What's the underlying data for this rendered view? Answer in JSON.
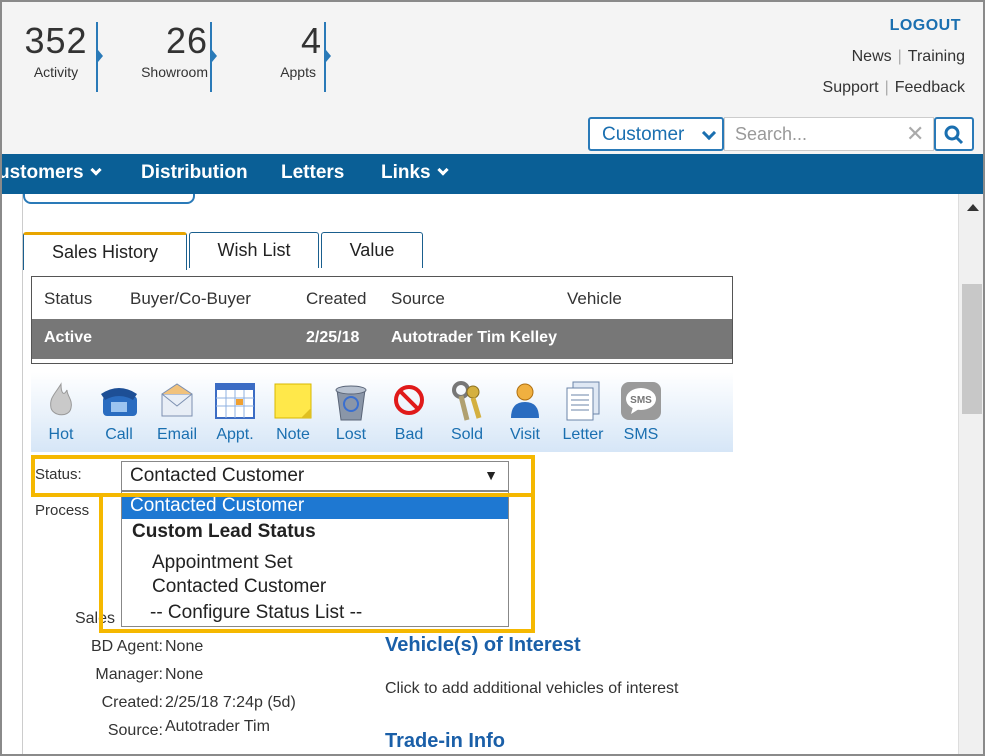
{
  "stats": [
    {
      "value": "352",
      "label": "Activity"
    },
    {
      "value": "26",
      "label": "Showroom"
    },
    {
      "value": "4",
      "label": "Appts"
    }
  ],
  "header": {
    "logout": "LOGOUT",
    "links_row1": [
      "News",
      "Training"
    ],
    "links_row2": [
      "Support",
      "Feedback"
    ]
  },
  "search": {
    "type": "Customer",
    "placeholder": "Search...",
    "clear": "✕"
  },
  "nav": {
    "items": [
      "ustomers",
      "Distribution",
      "Letters",
      "Links"
    ]
  },
  "tabs": [
    "Sales History",
    "Wish List",
    "Value"
  ],
  "sales_table": {
    "headers": [
      "Status",
      "Buyer/Co-Buyer",
      "Created",
      "Source",
      "Vehicle"
    ],
    "row": {
      "status": "Active",
      "buyer": "",
      "created": "2/25/18",
      "source": "Autotrader Tim Kelley",
      "vehicle": ""
    }
  },
  "actions": [
    "Hot",
    "Call",
    "Email",
    "Appt.",
    "Note",
    "Lost",
    "Bad",
    "Sold",
    "Visit",
    "Letter",
    "SMS"
  ],
  "status": {
    "label": "Status:",
    "selected": "Contacted Customer",
    "arrow": "▼",
    "process_label": "Process",
    "options": [
      {
        "text": "Contacted Customer",
        "kind": "selected"
      },
      {
        "text": "Custom Lead Status",
        "kind": "group"
      },
      {
        "text": "Appointment Set",
        "kind": "option"
      },
      {
        "text": "Contacted Customer",
        "kind": "option"
      },
      {
        "text": "-- Configure Status List --",
        "kind": "config"
      }
    ]
  },
  "details": {
    "sales_label": "Sales",
    "bd_agent_label": "BD Agent:",
    "bd_agent": "None",
    "manager_label": "Manager:",
    "manager": "None",
    "created_label": "Created:",
    "created": "2/25/18 7:24p (5d)",
    "source_label": "Source:",
    "source": "Autotrader Tim"
  },
  "right": {
    "vehicles_heading": "Vehicle(s) of Interest",
    "vehicles_text": "Click to add additional vehicles of interest",
    "tradein_heading": "Trade-in Info"
  },
  "colors": {
    "nav_bg": "#0a5f96",
    "accent": "#1a6fb0",
    "highlight": "#f5b800",
    "selected_option": "#1e78d2"
  }
}
